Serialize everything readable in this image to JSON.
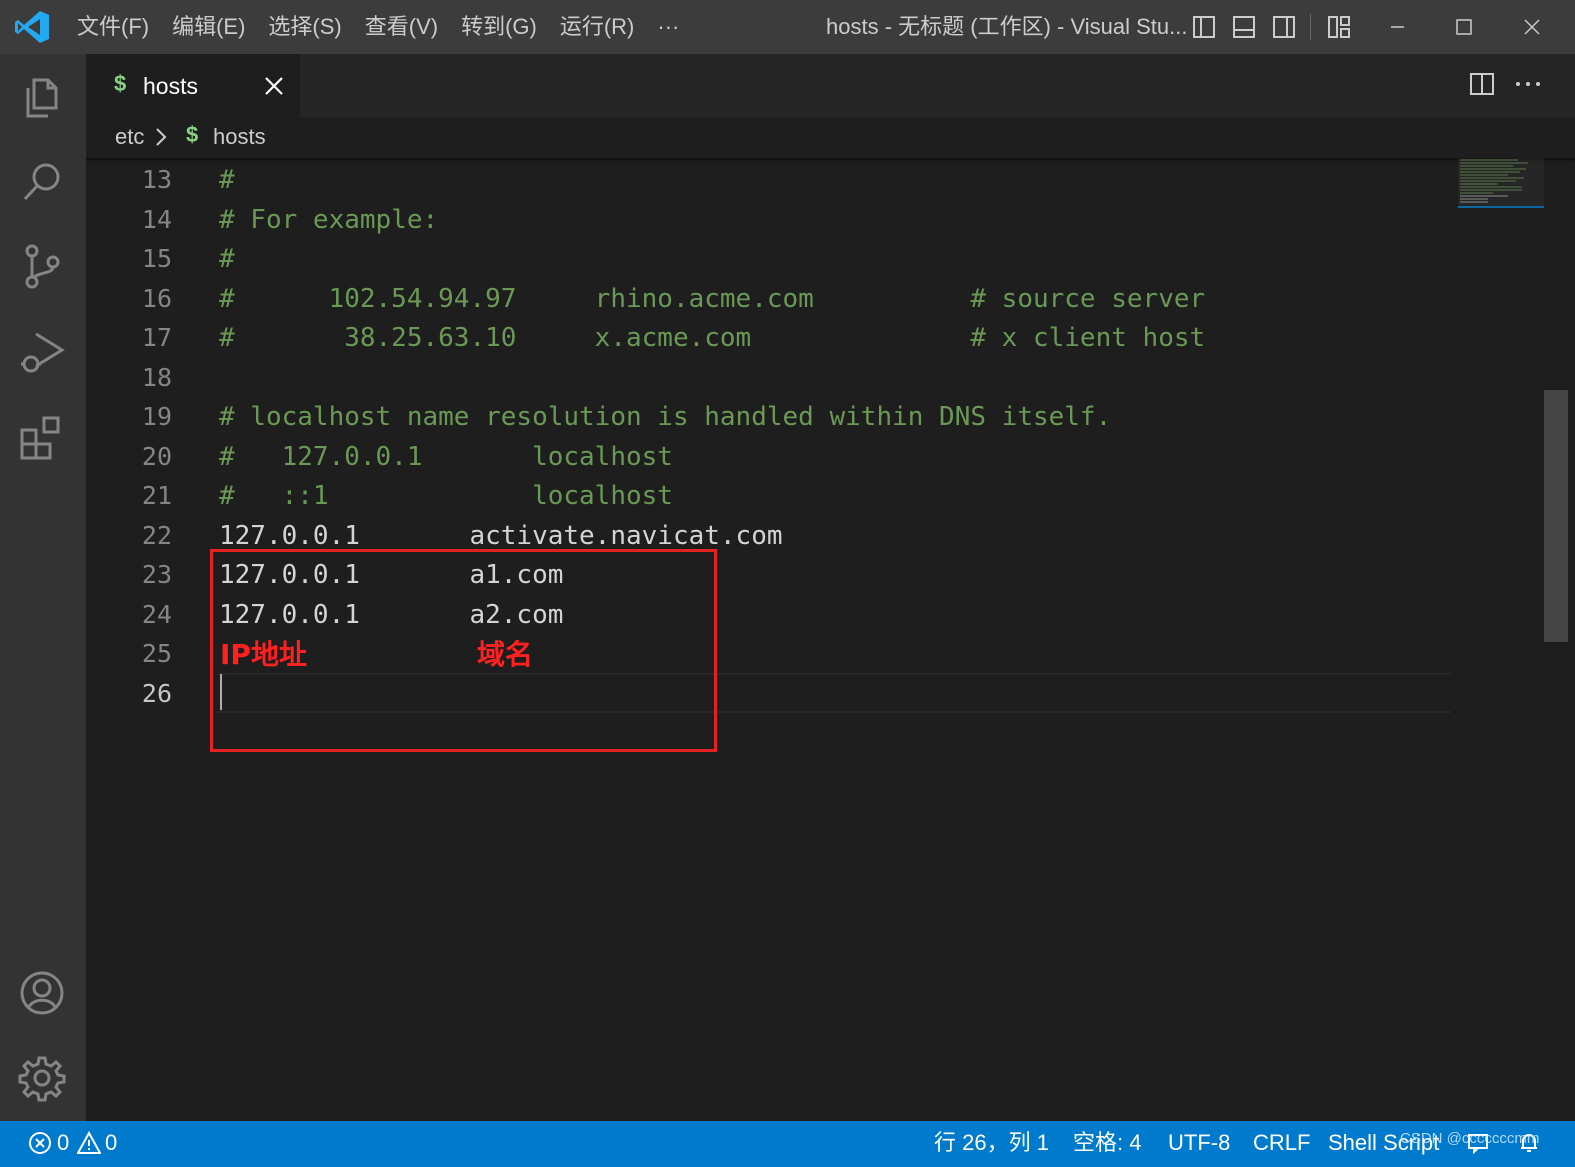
{
  "menu": [
    "文件(F)",
    "编辑(E)",
    "选择(S)",
    "查看(V)",
    "转到(G)",
    "运行(R)",
    "···"
  ],
  "window_title": "hosts - 无标题 (工作区) - Visual Stu...",
  "tab": {
    "icon_text": "$",
    "label": "hosts"
  },
  "breadcrumb": {
    "folder": "etc",
    "icon_text": "$",
    "file": "hosts"
  },
  "editor": {
    "lines": [
      {
        "num": "13",
        "text": "#",
        "kind": "comment"
      },
      {
        "num": "14",
        "text": "# For example:",
        "kind": "comment"
      },
      {
        "num": "15",
        "text": "#",
        "kind": "comment"
      },
      {
        "num": "16",
        "text": "#      102.54.94.97     rhino.acme.com          # source server",
        "kind": "comment"
      },
      {
        "num": "17",
        "text": "#       38.25.63.10     x.acme.com              # x client host",
        "kind": "comment"
      },
      {
        "num": "18",
        "text": "",
        "kind": "comment"
      },
      {
        "num": "19",
        "text": "# localhost name resolution is handled within DNS itself.",
        "kind": "comment"
      },
      {
        "num": "20",
        "text": "#   127.0.0.1       localhost",
        "kind": "comment"
      },
      {
        "num": "21",
        "text": "#   ::1             localhost",
        "kind": "comment"
      },
      {
        "num": "22",
        "text": "127.0.0.1       activate.navicat.com",
        "kind": "plain"
      },
      {
        "num": "23",
        "text": "127.0.0.1       a1.com",
        "kind": "plain"
      },
      {
        "num": "24",
        "text": "127.0.0.1       a2.com",
        "kind": "plain"
      },
      {
        "num": "25",
        "text": "",
        "kind": "plain"
      },
      {
        "num": "26",
        "text": "",
        "kind": "plain"
      }
    ],
    "annotation_ip": "IP地址",
    "annotation_domain": "域名"
  },
  "status": {
    "errors": "0",
    "warnings": "0",
    "position": "行 26，列 1",
    "spaces": "空格: 4",
    "encoding": "UTF-8",
    "eol": "CRLF",
    "language": "Shell Script"
  },
  "watermark": "CSDN @cccccccmm",
  "colors": {
    "accent": "#007acc",
    "comment": "#6a9955",
    "annotation": "#e32222"
  }
}
